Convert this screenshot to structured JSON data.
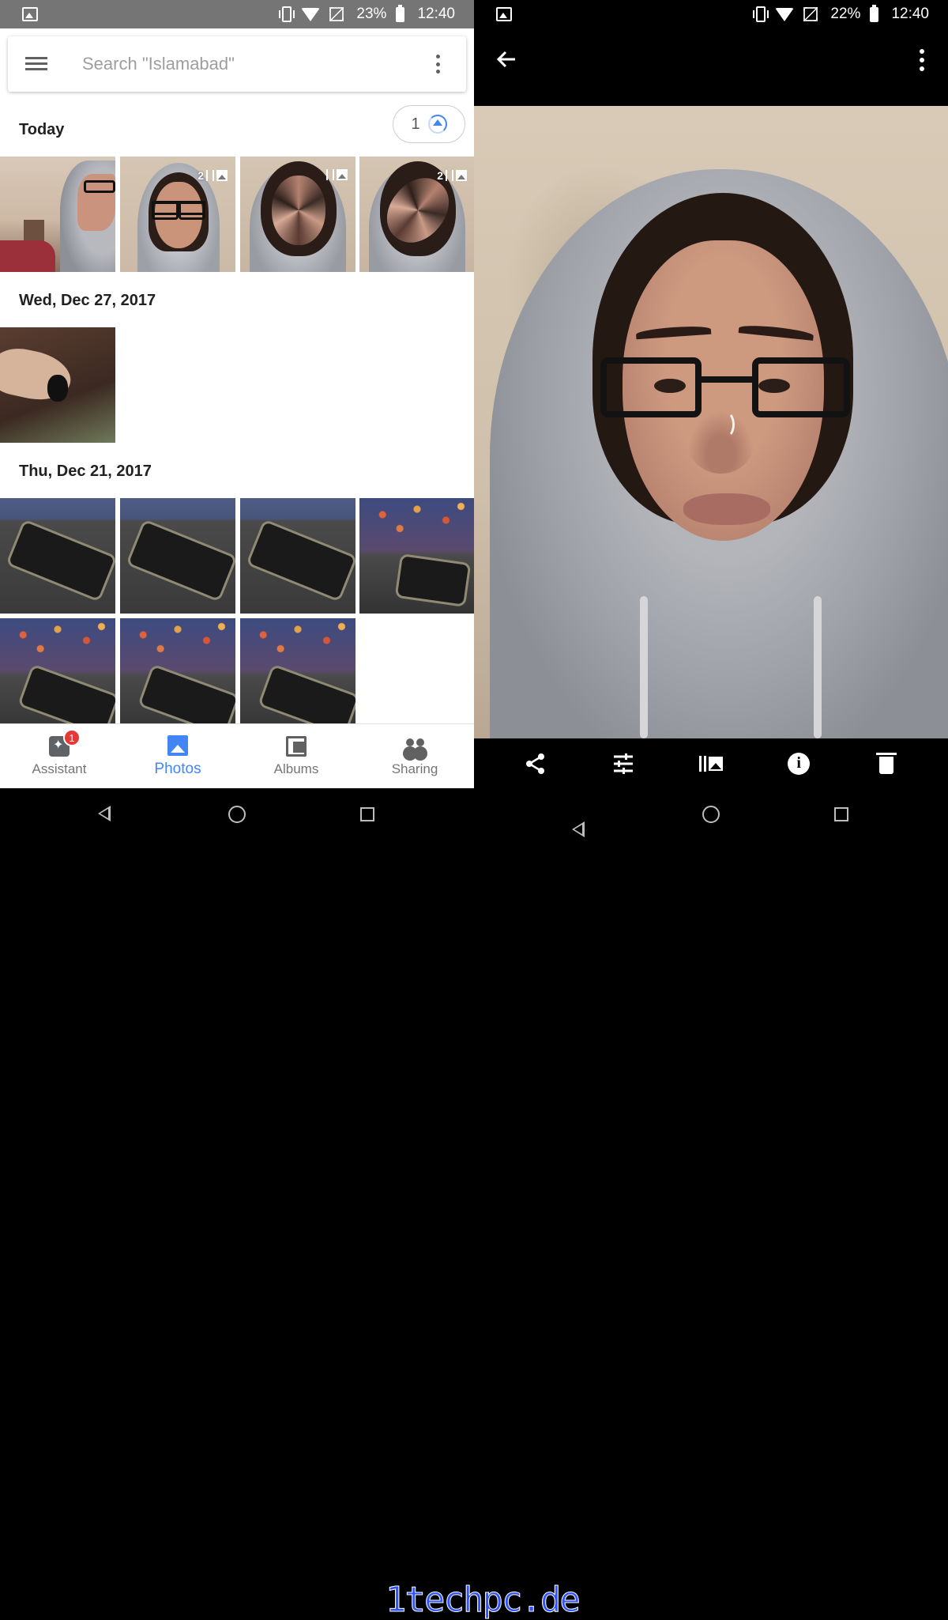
{
  "left_screen": {
    "status_bar": {
      "battery_percent": "23%",
      "time": "12:40"
    },
    "search": {
      "placeholder": "Search \"Islamabad\""
    },
    "upload_indicator": {
      "count": "1"
    },
    "sections": [
      {
        "title": "Today"
      },
      {
        "title": "Wed, Dec 27, 2017"
      },
      {
        "title": "Thu, Dec 21, 2017"
      }
    ],
    "burst_counts": [
      "2",
      "",
      "2"
    ],
    "bottom_nav": {
      "items": [
        {
          "label": "Assistant",
          "icon": "assistant-icon",
          "badge": "1"
        },
        {
          "label": "Photos",
          "icon": "photos-icon",
          "active": true
        },
        {
          "label": "Albums",
          "icon": "albums-icon"
        },
        {
          "label": "Sharing",
          "icon": "sharing-icon"
        }
      ]
    },
    "accent_color": "#4285f4"
  },
  "right_screen": {
    "status_bar": {
      "battery_percent": "22%",
      "time": "12:40"
    },
    "toolbar_icons": [
      "back-arrow-icon",
      "more-vert-icon"
    ],
    "action_icons": [
      "share-icon",
      "edit-sliders-icon",
      "burst-icon",
      "info-icon",
      "delete-icon"
    ],
    "info_glyph": "i"
  },
  "watermark": "1techpc.de"
}
